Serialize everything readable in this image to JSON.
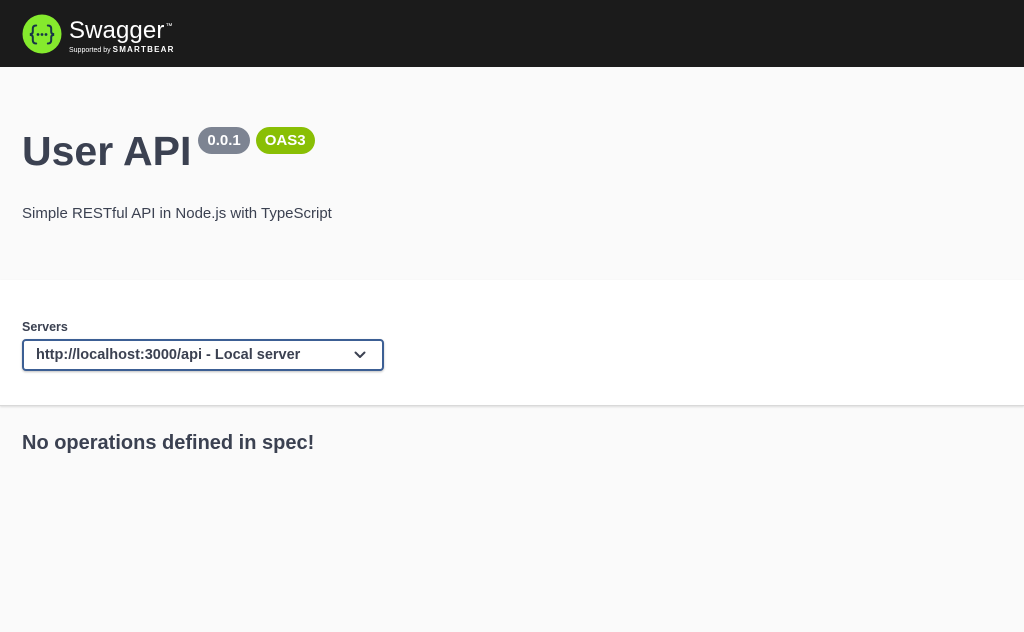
{
  "topbar": {
    "logo_title": "Swagger",
    "logo_tm": "™",
    "logo_supported": "Supported by",
    "logo_brand": "SMARTBEAR",
    "logo_icon": "swagger-braces-icon",
    "background": "#1b1b1b",
    "logo_color": "#85ea2d"
  },
  "info": {
    "title": "User API",
    "version": "0.0.1",
    "oas_badge": "OAS3",
    "description": "Simple RESTful API in Node.js with TypeScript",
    "version_color": "#7d8492",
    "oas_color": "#89bf04"
  },
  "servers": {
    "label": "Servers",
    "selected": "http://localhost:3000/api - Local server",
    "dropdown_icon": "chevron-down-icon"
  },
  "operations": {
    "empty_message": "No operations defined in spec!"
  }
}
